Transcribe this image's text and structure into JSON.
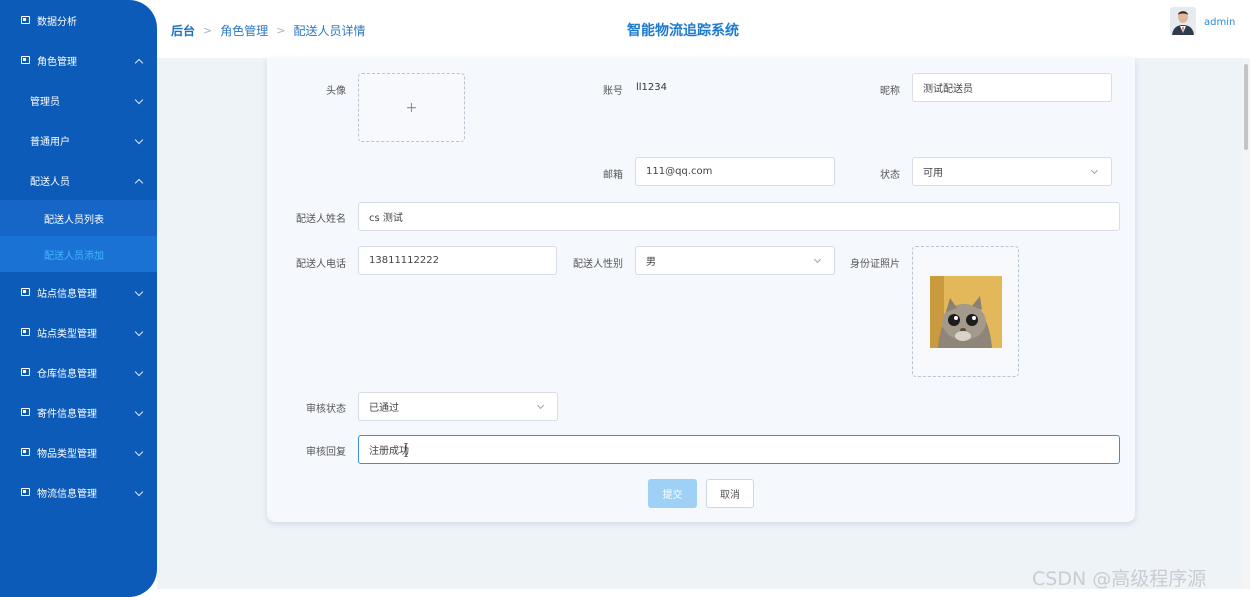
{
  "sidebar": {
    "items": [
      {
        "label": "数据分析"
      },
      {
        "label": "角色管理"
      },
      {
        "label": "管理员"
      },
      {
        "label": "普通用户"
      },
      {
        "label": "配送人员"
      },
      {
        "label": "配送人员列表"
      },
      {
        "label": "配送人员添加"
      },
      {
        "label": "站点信息管理"
      },
      {
        "label": "站点类型管理"
      },
      {
        "label": "仓库信息管理"
      },
      {
        "label": "寄件信息管理"
      },
      {
        "label": "物品类型管理"
      },
      {
        "label": "物流信息管理"
      }
    ],
    "active_item": "配送人员添加"
  },
  "header": {
    "breadcrumb": [
      "后台",
      "角色管理",
      "配送人员详情"
    ],
    "system_title": "智能物流追踪系统",
    "username": "admin"
  },
  "form": {
    "avatar_label": "头像",
    "account_label": "账号",
    "account_value": "ll1234",
    "nickname_label": "昵称",
    "nickname_value": "测试配送员",
    "email_label": "邮箱",
    "email_value": "111@qq.com",
    "status_label": "状态",
    "status_value": "可用",
    "name_label": "配送人姓名",
    "name_value": "cs 测试",
    "phone_label": "配送人电话",
    "phone_value": "13811112222",
    "gender_label": "配送人性别",
    "gender_value": "男",
    "idphoto_label": "身份证照片",
    "review_status_label": "审核状态",
    "review_status_value": "已通过",
    "review_reply_label": "审核回复",
    "review_reply_value": "注册成功",
    "submit_label": "提交",
    "cancel_label": "取消"
  },
  "watermark": "CSDN @高级程序源",
  "colors": {
    "sidebar_bg": "#0d5bb8",
    "accent": "#1e7bd0",
    "active_text": "#41b6ff",
    "submit_bg": "#9fd0f5"
  }
}
